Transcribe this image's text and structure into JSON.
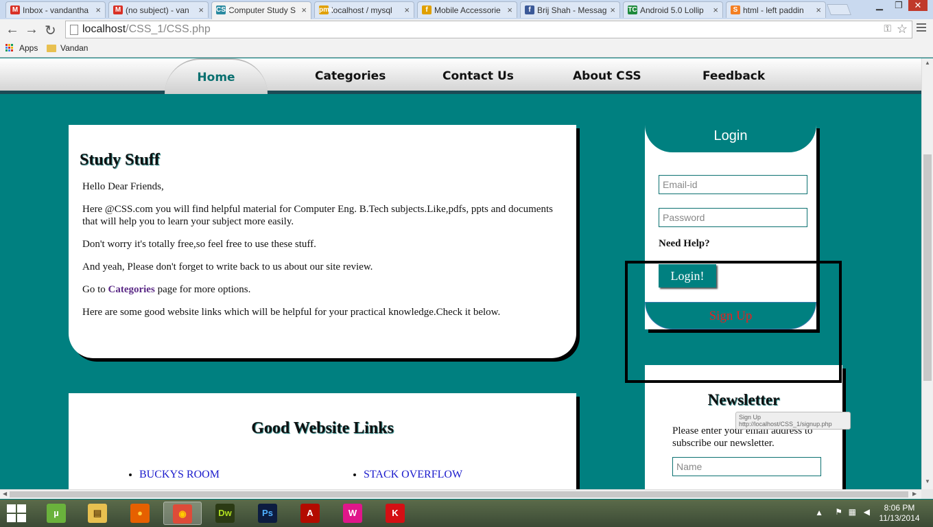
{
  "browser": {
    "tabs": [
      {
        "label": "Inbox - vandantha",
        "fav": "M",
        "fav_color": "#d93025"
      },
      {
        "label": "(no subject) - van",
        "fav": "M",
        "fav_color": "#d93025"
      },
      {
        "label": "Computer Study S",
        "fav": "CSS",
        "fav_color": "#2a8aa0"
      },
      {
        "label": "localhost / mysql",
        "fav": "pma",
        "fav_color": "#e0a000"
      },
      {
        "label": "Mobile Accessorie",
        "fav": "f",
        "fav_color": "#e0a000"
      },
      {
        "label": "Brij Shah - Messag",
        "fav": "f",
        "fav_color": "#3b5998"
      },
      {
        "label": "Android 5.0 Lollip",
        "fav": "TC",
        "fav_color": "#1e8a3c"
      },
      {
        "label": "html - left paddin",
        "fav": "S",
        "fav_color": "#f48024"
      }
    ],
    "close_glyph": "×",
    "url_host": "localhost",
    "url_path": "/CSS_1/CSS.php",
    "bookmarks": {
      "apps": "Apps",
      "folder": "Vandan"
    }
  },
  "site": {
    "nav": [
      "Home",
      "Categories",
      "Contact Us",
      "About CSS",
      "Feedback"
    ],
    "study": {
      "title": "Study Stuff",
      "p1": "Hello Dear Friends,",
      "p2": "Here @CSS.com you will find helpful material for Computer Eng. B.Tech subjects.Like,pdfs, ppts and documents that will help you to learn your subject more easily.",
      "p3": "Don't worry it's totally free,so feel free to use these stuff.",
      "p4": "And yeah, Please don't forget to write back to us about our site review.",
      "p5_pre": "Go to ",
      "p5_link": "Categories",
      "p5_post": " page for more options.",
      "p6": "Here are some good website links which will be helpful for your practical knowledge.Check it below."
    },
    "links": {
      "title": "Good Website Links",
      "left": "BUCKYS ROOM",
      "right": "STACK OVERFLOW"
    },
    "login": {
      "title": "Login",
      "email_placeholder": "Email-id",
      "password_placeholder": "Password",
      "need_help": "Need Help?",
      "login_button": "Login!",
      "signup": "Sign Up"
    },
    "newsletter": {
      "title": "Newsletter",
      "text": "Please enter your email address to subscribe our newsletter.",
      "name_placeholder": "Name"
    },
    "tooltip": {
      "title": "Sign Up",
      "url": "http://localhost/CSS_1/signup.php"
    }
  },
  "taskbar": {
    "apps": [
      {
        "name": "utorrent",
        "glyph": "µ",
        "bg": "#6ab23c",
        "color": "#fff"
      },
      {
        "name": "explorer",
        "glyph": "▤",
        "bg": "#e8c050",
        "color": "#6b4a10"
      },
      {
        "name": "firefox",
        "glyph": "●",
        "bg": "#e66000",
        "color": "#ffd040"
      },
      {
        "name": "chrome",
        "glyph": "◉",
        "bg": "#dd4b39",
        "color": "#ffcc00"
      },
      {
        "name": "dreamweaver",
        "glyph": "Dw",
        "bg": "#2b3a14",
        "color": "#b0e020"
      },
      {
        "name": "photoshop",
        "glyph": "Ps",
        "bg": "#0c1c40",
        "color": "#4fb0ff"
      },
      {
        "name": "acrobat",
        "glyph": "A",
        "bg": "#b30b00",
        "color": "#fff"
      },
      {
        "name": "wamp",
        "glyph": "W",
        "bg": "#e0168a",
        "color": "#fff"
      },
      {
        "name": "kaspersky",
        "glyph": "K",
        "bg": "#d40f14",
        "color": "#fff"
      }
    ],
    "time": "8:06 PM",
    "date": "11/13/2014"
  }
}
